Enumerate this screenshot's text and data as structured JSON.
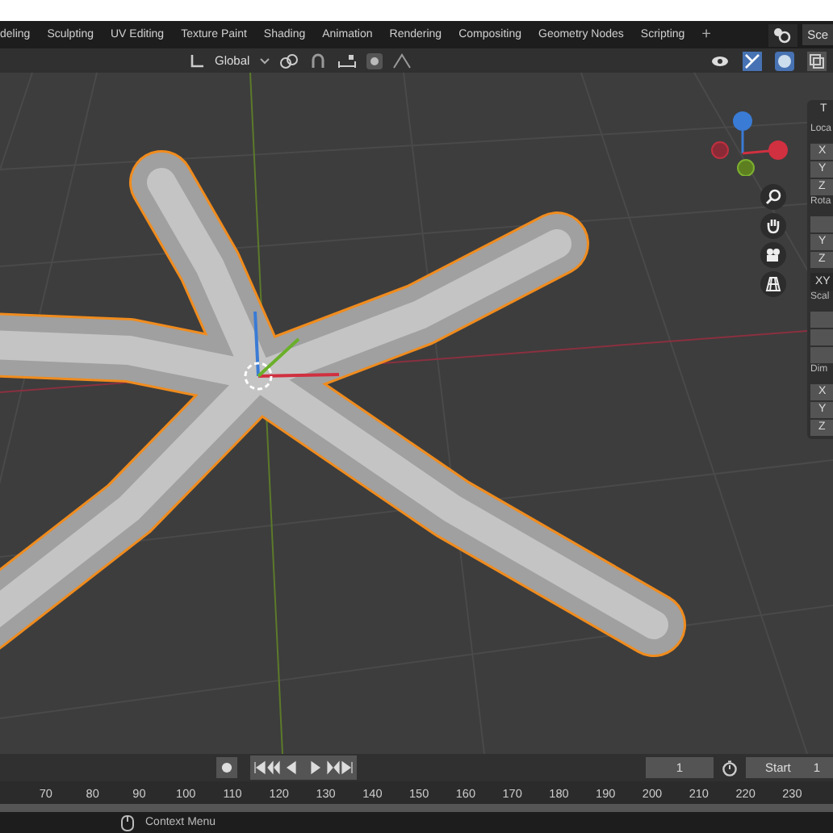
{
  "workspace_tabs": [
    {
      "label": "deling",
      "selected": false
    },
    {
      "label": "Sculpting",
      "selected": false
    },
    {
      "label": "UV Editing",
      "selected": false
    },
    {
      "label": "Texture Paint",
      "selected": false
    },
    {
      "label": "Shading",
      "selected": false
    },
    {
      "label": "Animation",
      "selected": false
    },
    {
      "label": "Rendering",
      "selected": false
    },
    {
      "label": "Compositing",
      "selected": false
    },
    {
      "label": "Geometry Nodes",
      "selected": false
    },
    {
      "label": "Scripting",
      "selected": false
    }
  ],
  "add_workspace": "+",
  "scene_label": "Sce",
  "header": {
    "transform_orientation": "Global",
    "proportional_editing": true,
    "xray": true
  },
  "sidebar": {
    "tab_title": "T",
    "sections": [
      {
        "label": "Loca",
        "kind": "vector",
        "fields": [
          "X",
          "Y",
          "Z"
        ]
      },
      {
        "label": "Rota",
        "kind": "rotation",
        "fields": [
          "Y",
          "Z"
        ],
        "mode": "XY"
      },
      {
        "label": "Scal",
        "kind": "blank"
      },
      {
        "label": "Dim",
        "kind": "vector",
        "fields": [
          "X",
          "Y",
          "Z"
        ]
      }
    ]
  },
  "timeline": {
    "current_frame": "1",
    "start_label": "Start",
    "start_value": "1",
    "ruler": [
      "70",
      "80",
      "90",
      "100",
      "110",
      "120",
      "130",
      "140",
      "150",
      "160",
      "170",
      "180",
      "190",
      "200",
      "210",
      "220",
      "230"
    ]
  },
  "status_bar": {
    "hint": "Context Menu"
  }
}
